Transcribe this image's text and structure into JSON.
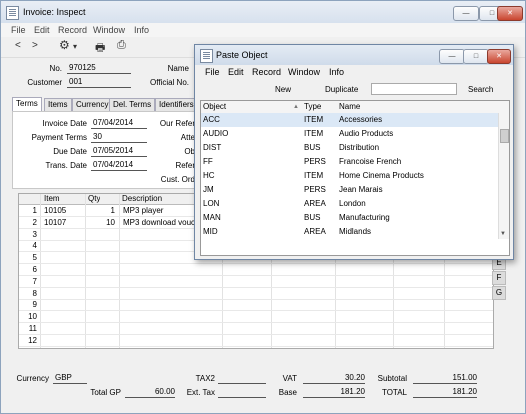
{
  "window": {
    "title": "Invoice: Inspect",
    "min": "—",
    "max": "□",
    "close": "✕"
  },
  "menu": [
    "File",
    "Edit",
    "Record",
    "Window",
    "Info"
  ],
  "toolbar": {
    "back": "<",
    "forward": ">",
    "gear": "⚙",
    "gear_caret": "▾",
    "print": "🖶",
    "preview": "⎙"
  },
  "header": {
    "no_label": "No.",
    "no_value": "970125",
    "customer_label": "Customer",
    "customer_value": "001",
    "name_label": "Name",
    "official_label": "Official No."
  },
  "tabs": [
    "Terms",
    "Items",
    "Currency",
    "Del. Terms",
    "Identifiers"
  ],
  "terms": {
    "invoice_date_label": "Invoice Date",
    "invoice_date": "07/04/2014",
    "payment_terms_label": "Payment Terms",
    "payment_terms": "30",
    "due_date_label": "Due Date",
    "due_date": "07/05/2014",
    "trans_date_label": "Trans. Date",
    "trans_date": "07/04/2014",
    "our_ref_label": "Our Refer",
    "atte_label": "Atte",
    "ob_label": "Ob",
    "refer_label": "Refer",
    "cust_ord_label": "Cust. Ord"
  },
  "grid": {
    "headers": [
      "Item",
      "Qty",
      "Description"
    ],
    "rows": [
      {
        "n": "1",
        "item": "10105",
        "qty": "1",
        "desc": "MP3 player"
      },
      {
        "n": "2",
        "item": "10107",
        "qty": "10",
        "desc": "MP3 download vouche"
      },
      {
        "n": "3"
      },
      {
        "n": "4"
      },
      {
        "n": "5"
      },
      {
        "n": "6"
      },
      {
        "n": "7"
      },
      {
        "n": "8"
      },
      {
        "n": "9"
      },
      {
        "n": "10"
      },
      {
        "n": "11"
      },
      {
        "n": "12"
      }
    ],
    "side_buttons": [
      "E",
      "F",
      "G"
    ]
  },
  "footer": {
    "currency_label": "Currency",
    "currency_value": "GBP",
    "tax2_label": "TAX2",
    "tax2_value": "",
    "vat_label": "VAT",
    "vat_value": "30.20",
    "subtotal_label": "Subtotal",
    "subtotal_value": "151.00",
    "total_gp_label": "Total GP",
    "total_gp_value": "60.00",
    "ext_tax_label": "Ext. Tax",
    "ext_tax_value": "",
    "base_label": "Base",
    "base_value": "181.20",
    "total_label": "TOTAL",
    "total_value": "181.20"
  },
  "dialog": {
    "title": "Paste Object",
    "menu": [
      "File",
      "Edit",
      "Record",
      "Window",
      "Info"
    ],
    "new_button": "New",
    "duplicate_button": "Duplicate",
    "search_button": "Search",
    "search_value": "",
    "columns": [
      "Object",
      "Type",
      "Name"
    ],
    "rows": [
      {
        "object": "ACC",
        "type": "ITEM",
        "name": "Accessories"
      },
      {
        "object": "AUDIO",
        "type": "ITEM",
        "name": "Audio Products"
      },
      {
        "object": "DIST",
        "type": "BUS",
        "name": "Distribution"
      },
      {
        "object": "FF",
        "type": "PERS",
        "name": "Francoise French"
      },
      {
        "object": "HC",
        "type": "ITEM",
        "name": "Home Cinema Products"
      },
      {
        "object": "JM",
        "type": "PERS",
        "name": "Jean Marais"
      },
      {
        "object": "LON",
        "type": "AREA",
        "name": "London"
      },
      {
        "object": "MAN",
        "type": "BUS",
        "name": "Manufacturing"
      },
      {
        "object": "MID",
        "type": "AREA",
        "name": "Midlands"
      }
    ]
  }
}
